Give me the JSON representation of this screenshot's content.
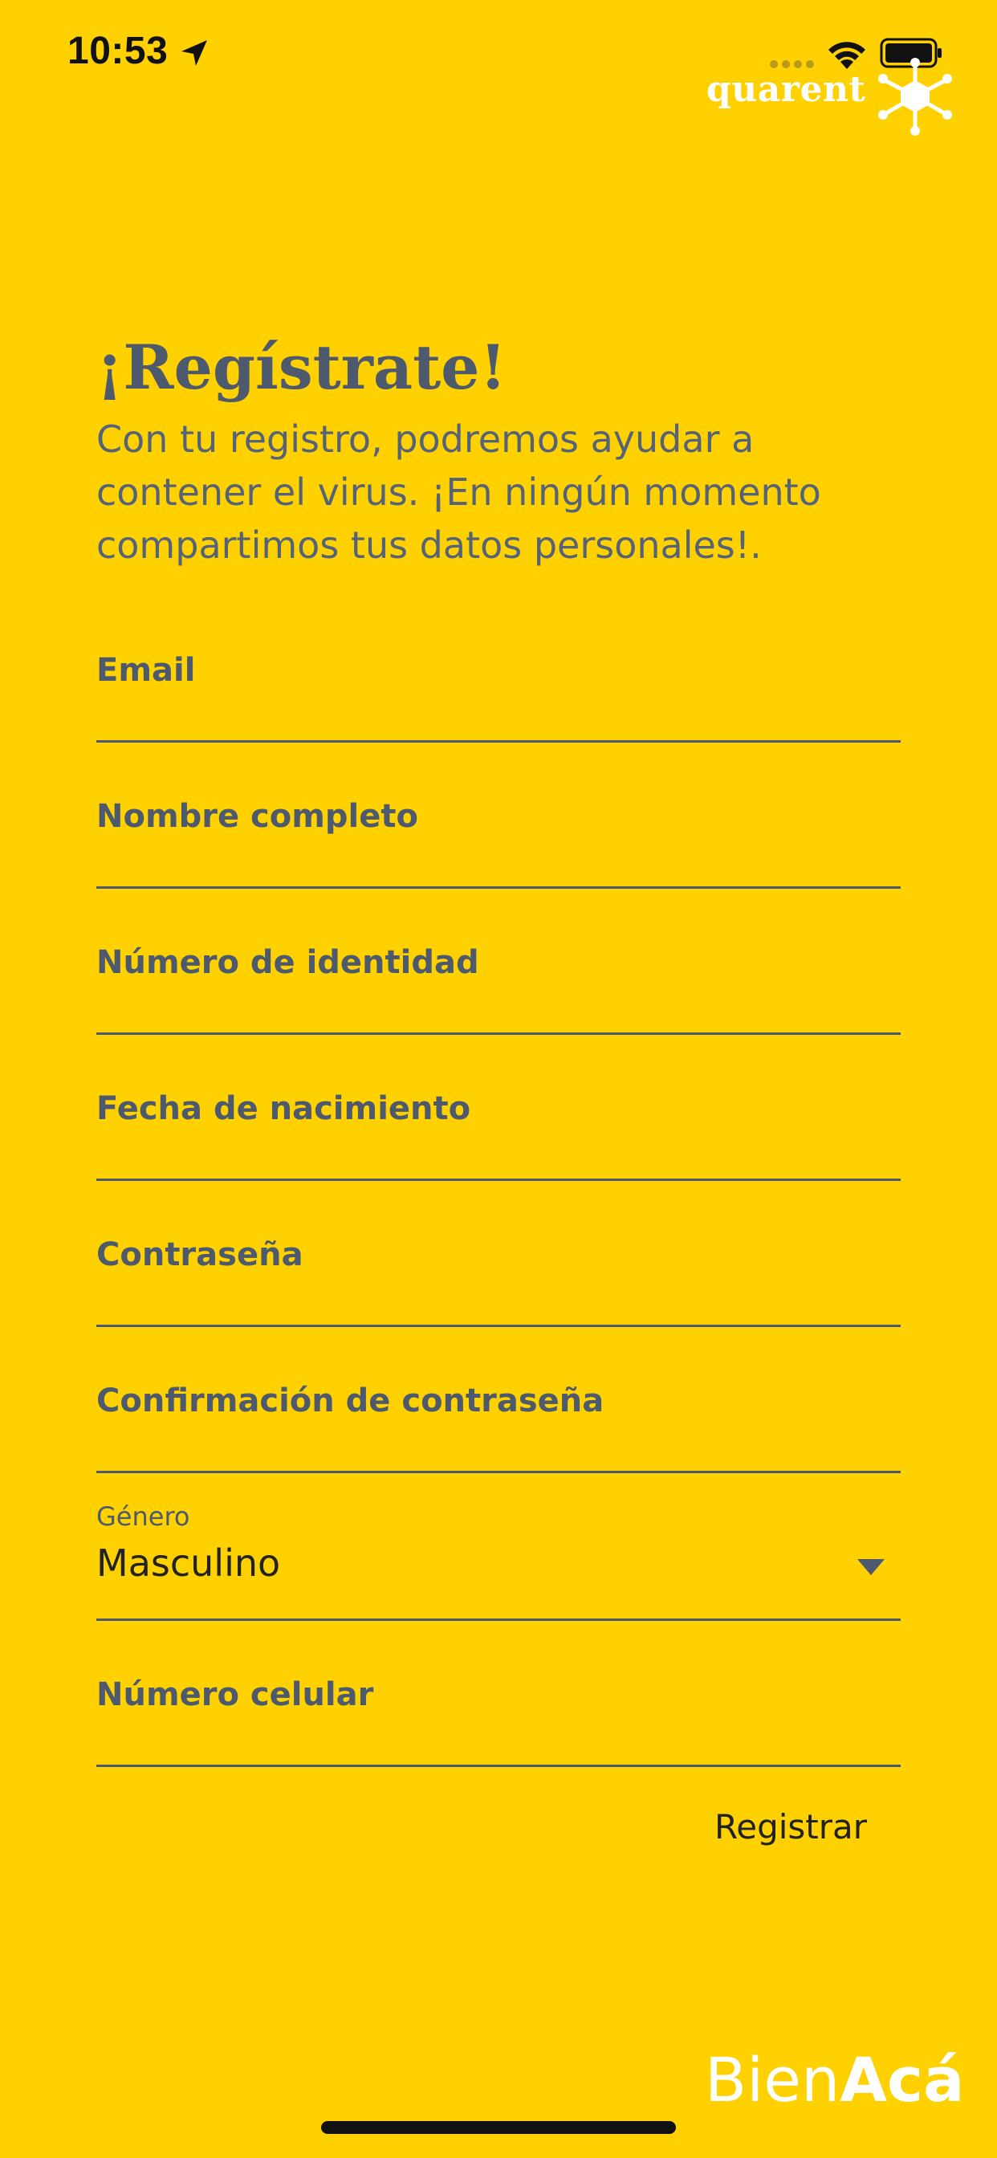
{
  "status_bar": {
    "time": "10:53"
  },
  "brand": {
    "name": "quarent"
  },
  "header": {
    "title": "¡Regístrate!",
    "subtitle": "Con tu registro, podremos ayudar a contener el virus. ¡En ningún momento compartimos tus datos personales!."
  },
  "form": {
    "email_label": "Email",
    "name_label": "Nombre completo",
    "id_label": "Número de identidad",
    "birthdate_label": "Fecha de nacimiento",
    "password_label": "Contraseña",
    "password_confirm_label": "Confirmación de contraseña",
    "gender": {
      "label": "Género",
      "value": "Masculino"
    },
    "phone_label": "Número celular",
    "submit_label": "Registrar"
  },
  "footer": {
    "logo_light": "Bien",
    "logo_bold": "Acá"
  },
  "colors": {
    "background": "#FFD100",
    "text_primary": "#4D5A6E",
    "accent_white": "#FFFFFF"
  }
}
